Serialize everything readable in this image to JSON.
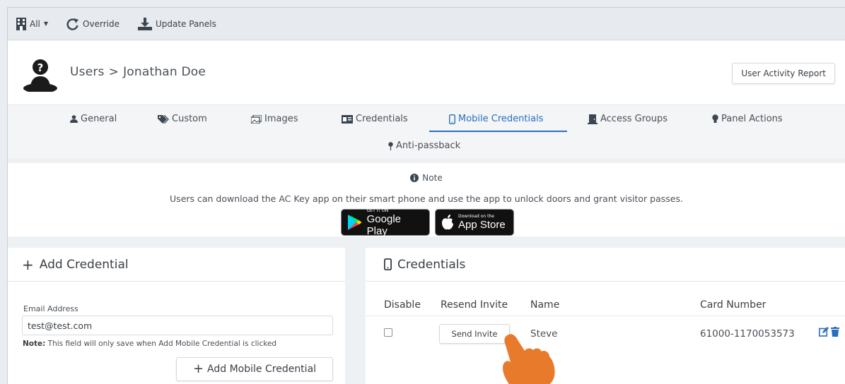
{
  "toolbar": {
    "all_label": "All",
    "override_label": "Override",
    "update_panels_label": "Update Panels"
  },
  "header": {
    "breadcrumb_root": "Users",
    "breadcrumb_sep": ">",
    "breadcrumb_current": "Jonathan Doe",
    "report_button": "User Activity Report"
  },
  "tabs": [
    {
      "label": "General"
    },
    {
      "label": "Custom"
    },
    {
      "label": "Images"
    },
    {
      "label": "Credentials"
    },
    {
      "label": "Mobile Credentials"
    },
    {
      "label": "Access Groups"
    },
    {
      "label": "Panel Actions"
    },
    {
      "label": "Anti-passback"
    }
  ],
  "active_tab": "Mobile Credentials",
  "note": {
    "title": "Note",
    "text": "Users can download the AC Key app on their smart phone and use the app to unlock doors and grant visitor passes.",
    "google_small": "GET IT ON",
    "google_big": "Google Play",
    "apple_small": "Download on the",
    "apple_big": "App Store"
  },
  "add_credential": {
    "title": "Add Credential",
    "email_label": "Email Address",
    "email_value": "test@test.com",
    "note_bold": "Note:",
    "note_text": " This field will only save when Add Mobile Credential is clicked",
    "add_button": "Add Mobile Credential"
  },
  "credentials": {
    "title": "Credentials",
    "columns": [
      "Disable",
      "Resend Invite",
      "Name",
      "Card Number"
    ],
    "rows": [
      {
        "disabled": false,
        "resend_label": "Send Invite",
        "name": "Steve",
        "card_number": "61000-1170053573"
      }
    ]
  },
  "colors": {
    "accent": "#2a6ebd",
    "hand": "#e87a2c"
  }
}
